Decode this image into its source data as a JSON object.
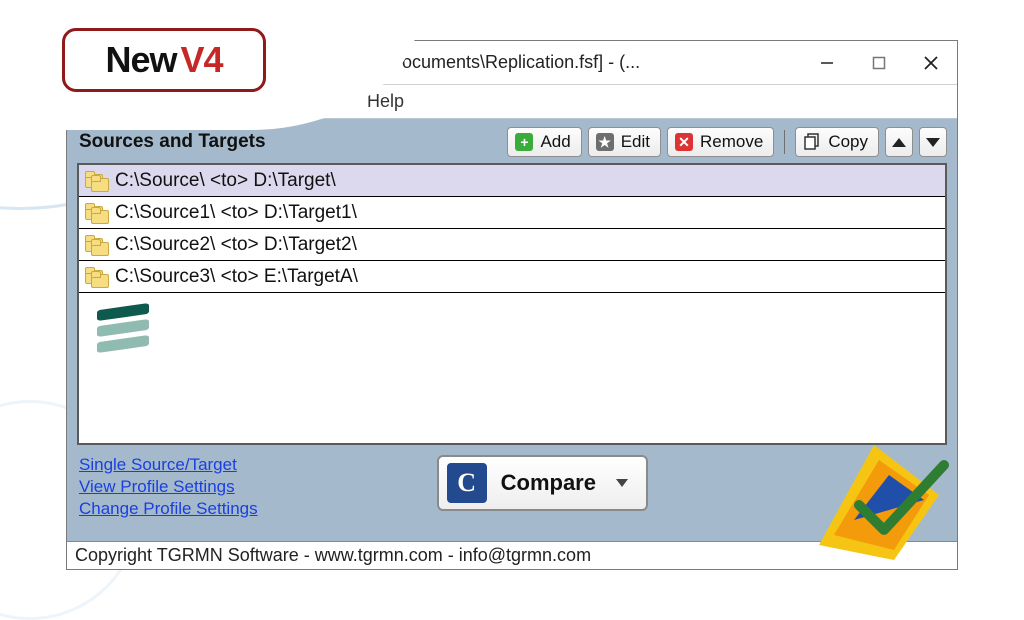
{
  "badge": {
    "left": "New",
    "right": "V4"
  },
  "window": {
    "title_fragment": "lic\\Documents\\Replication.fsf] - (...",
    "menu_help": "Help"
  },
  "section": {
    "label": "Sources and Targets"
  },
  "toolbar": {
    "add": "Add",
    "edit": "Edit",
    "remove": "Remove",
    "copy": "Copy"
  },
  "rows": [
    {
      "text": "C:\\Source\\ <to> D:\\Target\\",
      "selected": true
    },
    {
      "text": "C:\\Source1\\ <to> D:\\Target1\\",
      "selected": false
    },
    {
      "text": "C:\\Source2\\ <to> D:\\Target2\\",
      "selected": false
    },
    {
      "text": "C:\\Source3\\ <to> E:\\TargetA\\",
      "selected": false
    }
  ],
  "links": {
    "single": "Single Source/Target",
    "view": "View Profile Settings",
    "change": "Change Profile Settings"
  },
  "compare": {
    "label": "Compare",
    "logo_letter": "C"
  },
  "status": "Copyright TGRMN Software - www.tgrmn.com - info@tgrmn.com"
}
